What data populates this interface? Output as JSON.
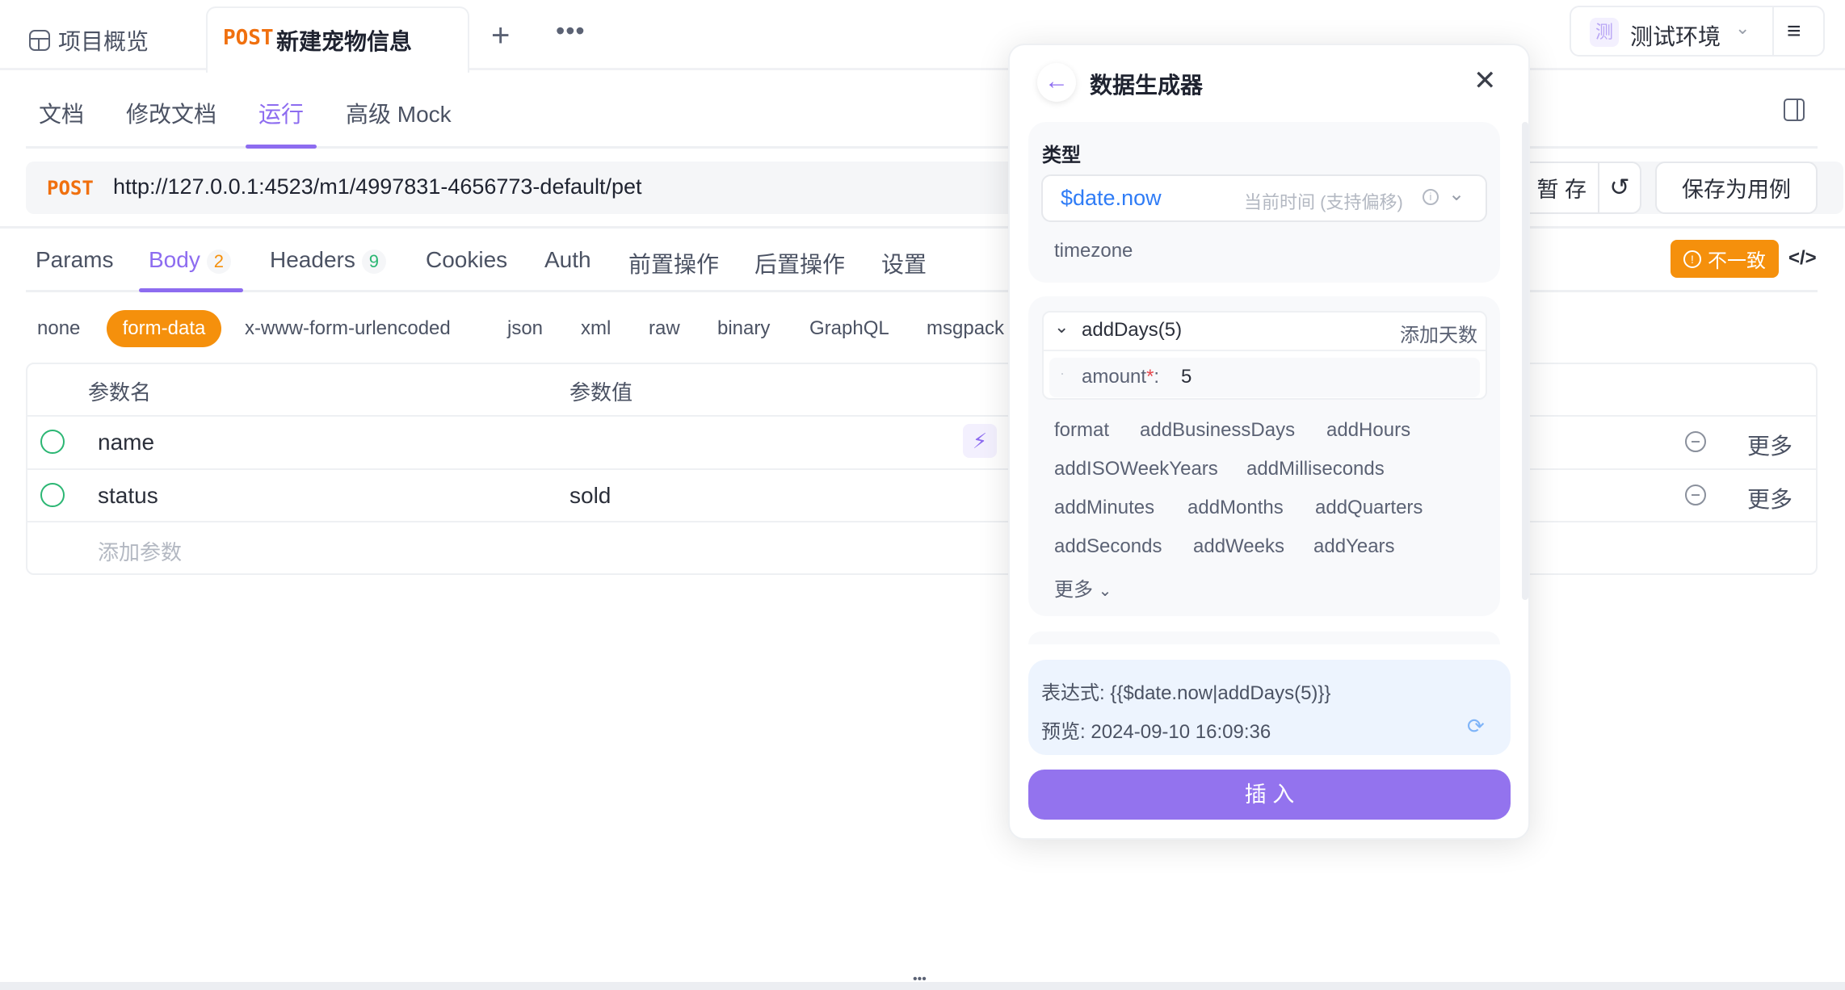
{
  "top_tabs": {
    "overview": "项目概览",
    "active_method": "POST",
    "active_title": "新建宠物信息"
  },
  "env": {
    "badge": "测",
    "label": "测试环境"
  },
  "sub_tabs": [
    "文档",
    "修改文档",
    "运行",
    "高级 Mock"
  ],
  "request": {
    "method": "POST",
    "url": "http://127.0.0.1:4523/m1/4997831-4656773-default/pet",
    "save_label": "暂 存",
    "save_case_label": "保存为用例"
  },
  "req_tabs": [
    {
      "label": "Params"
    },
    {
      "label": "Body",
      "count": "2"
    },
    {
      "label": "Headers",
      "count": "9"
    },
    {
      "label": "Cookies"
    },
    {
      "label": "Auth"
    },
    {
      "label": "前置操作"
    },
    {
      "label": "后置操作"
    },
    {
      "label": "设置"
    }
  ],
  "mismatch_label": "不一致",
  "body_types": [
    "none",
    "form-data",
    "x-www-form-urlencoded",
    "json",
    "xml",
    "raw",
    "binary",
    "GraphQL",
    "msgpack"
  ],
  "table": {
    "headers": [
      "参数名",
      "参数值"
    ],
    "rows": [
      {
        "name": "name",
        "value": "",
        "more": "更多"
      },
      {
        "name": "status",
        "value": "sold",
        "more": "更多"
      }
    ],
    "add_placeholder": "添加参数"
  },
  "generator": {
    "title": "数据生成器",
    "type_label": "类型",
    "type_value": "$date.now",
    "type_desc": "当前时间 (支持偏移)",
    "timezone": "timezone",
    "modifier": {
      "name": "addDays(5)",
      "desc": "添加天数",
      "param": "amount",
      "param_value": "5"
    },
    "methods": [
      "format",
      "addBusinessDays",
      "addHours",
      "addISOWeekYears",
      "addMilliseconds",
      "addMinutes",
      "addMonths",
      "addQuarters",
      "addSeconds",
      "addWeeks",
      "addYears"
    ],
    "more": "更多",
    "expression_label": "表达式:",
    "expression": "{{$date.now|addDays(5)}}",
    "preview_label": "预览:",
    "preview": "2024-09-10 16:09:36",
    "insert": "插 入"
  },
  "colors": {
    "accent": "#9373ee",
    "orange": "#f5900c",
    "success": "#2bb673",
    "link": "#2f7cf6"
  }
}
